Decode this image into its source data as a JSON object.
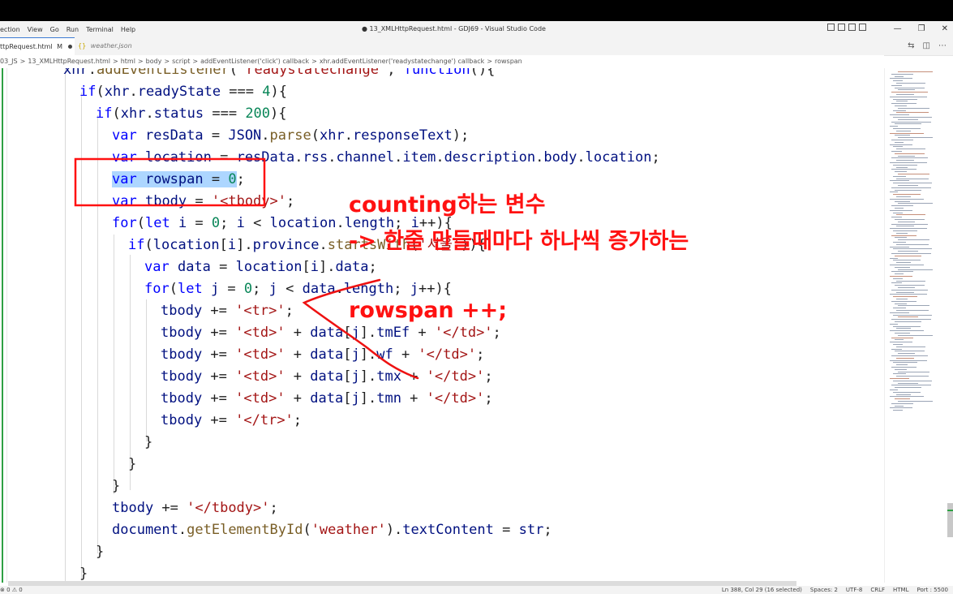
{
  "window": {
    "title": "● 13_XMLHttpRequest.html - GDJ69 - Visual Studio Code",
    "menu": [
      "ection",
      "View",
      "Go",
      "Run",
      "Terminal",
      "Help"
    ],
    "controls": [
      "—",
      "❐",
      "✕"
    ]
  },
  "tabs": [
    {
      "label": "ttpRequest.html",
      "status": "M"
    },
    {
      "label": "weather.json"
    }
  ],
  "breadcrumb": [
    "03_JS",
    ">",
    "13_XMLHttpRequest.html",
    ">",
    "html",
    ">",
    "body",
    ">",
    "script",
    ">",
    "addEventListener('click') callback",
    ">",
    "xhr.addEventListener('readystatechange') callback",
    ">",
    "rowspan"
  ],
  "code": [
    {
      "indent": 78,
      "text": "xhr.addEventListener('readystatechange', function(){"
    },
    {
      "indent": 98,
      "text": "if(xhr.readyState === 4){"
    },
    {
      "indent": 118,
      "text": "if(xhr.status === 200){"
    },
    {
      "indent": 138,
      "text": "var resData = JSON.parse(xhr.responseText);"
    },
    {
      "indent": 138,
      "text": "var location = resData.rss.channel.item.description.body.location;"
    },
    {
      "indent": 138,
      "text": "var rowspan = 0;"
    },
    {
      "indent": 138,
      "text": "var tbody = '<tbody>';"
    },
    {
      "indent": 138,
      "text": "for(let i = 0; i < location.length; i++){"
    },
    {
      "indent": 158,
      "text": "if(location[i].province.startsWith('서울')){"
    },
    {
      "indent": 178,
      "text": "var data = location[i].data;"
    },
    {
      "indent": 178,
      "text": "for(let j = 0; j < data.length; j++){"
    },
    {
      "indent": 198,
      "text": "tbody += '<tr>';"
    },
    {
      "indent": 198,
      "text": "tbody += '<td>' + data[j].tmEf + '</td>';"
    },
    {
      "indent": 198,
      "text": "tbody += '<td>' + data[j].wf + '</td>';"
    },
    {
      "indent": 198,
      "text": "tbody += '<td>' + data[j].tmx + '</td>';"
    },
    {
      "indent": 198,
      "text": "tbody += '<td>' + data[j].tmn + '</td>';"
    },
    {
      "indent": 198,
      "text": "tbody += '</tr>';"
    },
    {
      "indent": 178,
      "text": "}"
    },
    {
      "indent": 158,
      "text": "}"
    },
    {
      "indent": 138,
      "text": "}"
    },
    {
      "indent": 138,
      "text": "tbody += '</tbody>';"
    },
    {
      "indent": 138,
      "text": "document.getElementById('weather').textContent = str;"
    },
    {
      "indent": 118,
      "text": "}"
    },
    {
      "indent": 98,
      "text": "}"
    }
  ],
  "annotations": {
    "note1": "counting하는 변수",
    "note2": "-> 한줄 만들때마다 하나씩 증가하는",
    "note3": "rowspan ++;"
  },
  "status": {
    "left": "⊗ 0 ⚠ 0",
    "items": [
      "Ln 388, Col 29 (16 selected)",
      "Spaces: 2",
      "UTF-8",
      "CRLF",
      "HTML",
      "Port : 5500"
    ]
  },
  "colors": {
    "keyword": "#0000ff",
    "string": "#a31515",
    "property": "#001080",
    "function": "#795e26",
    "number": "#098658",
    "annotation": "#ff1111",
    "selection": "#add6ff"
  }
}
